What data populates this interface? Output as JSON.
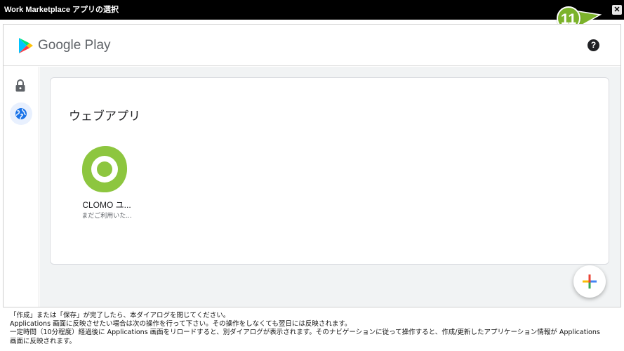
{
  "window": {
    "title": "Work Marketplace アプリの選択",
    "close_glyph": "✕"
  },
  "callout": {
    "number": "11"
  },
  "header": {
    "brand": "Google Play",
    "help_glyph": "?"
  },
  "sidebar": {
    "items": [
      {
        "name": "lock",
        "icon": "lock-icon",
        "active": false
      },
      {
        "name": "web-apps",
        "icon": "globe-icon",
        "active": true
      }
    ]
  },
  "main": {
    "section_title": "ウェブアプリ",
    "apps": [
      {
        "name": "CLOMO ユ...",
        "status": "まだご利用いた..."
      }
    ]
  },
  "fab": {
    "icon": "plus-icon"
  },
  "notes": [
    "「作成」または「保存」が完了したら、本ダイアログを閉じてください。",
    "Applications 画面に反映させたい場合は次の操作を行って下さい。その操作をしなくても翌日には反映されます。",
    "一定時間（10分程度）経過後に Applications 画面をリロードすると、別ダイアログが表示されます。そのナビゲーションに従って操作すると、作成/更新したアプリケーション情報が Applications",
    "画面に反映されます。"
  ],
  "colors": {
    "titlebar": "#000000",
    "callout_green": "#7cb32b",
    "app_icon_green": "#8dc63f",
    "content_bg": "#f1f3f4",
    "active_nav_bg": "#e8f0fe",
    "active_nav_icon": "#1a73e8"
  }
}
